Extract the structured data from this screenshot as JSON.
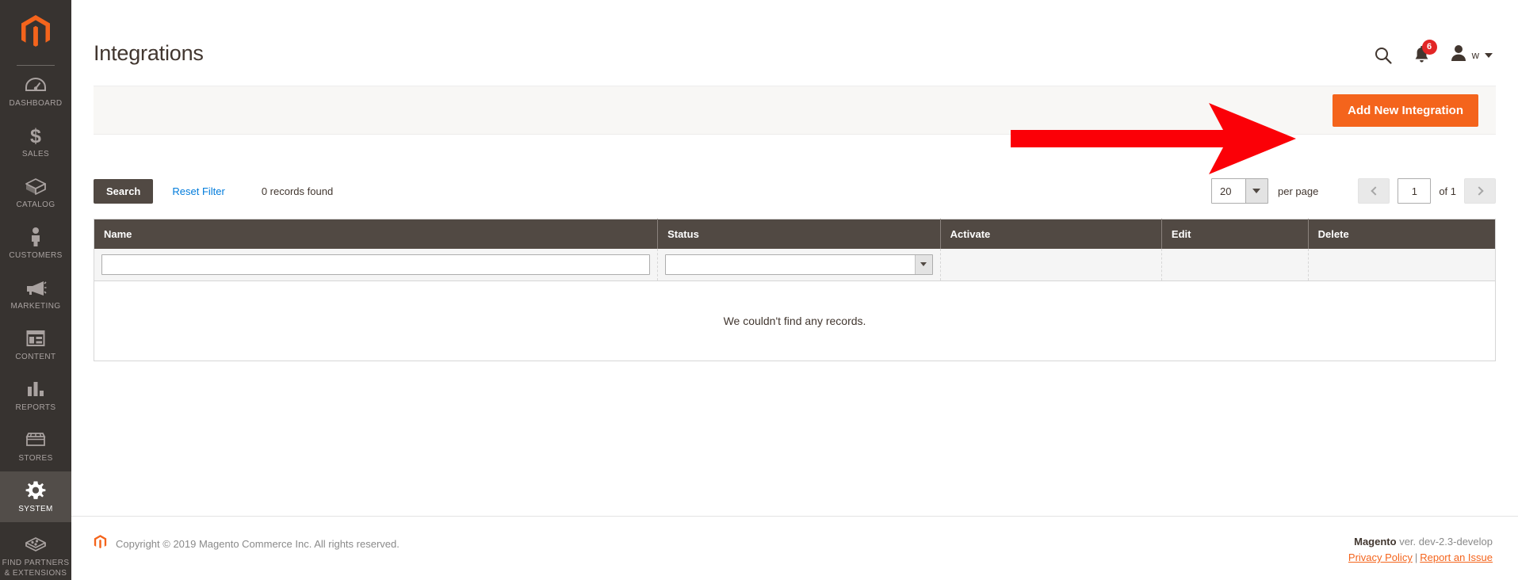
{
  "sidebar": {
    "logo_icon": "magento-logo-icon",
    "items": [
      {
        "label": "DASHBOARD",
        "icon": "dashboard-gauge-icon",
        "active": false
      },
      {
        "label": "SALES",
        "icon": "dollar-sign-icon",
        "active": false
      },
      {
        "label": "CATALOG",
        "icon": "box-icon",
        "active": false
      },
      {
        "label": "CUSTOMERS",
        "icon": "person-icon",
        "active": false
      },
      {
        "label": "MARKETING",
        "icon": "megaphone-icon",
        "active": false
      },
      {
        "label": "CONTENT",
        "icon": "layout-window-icon",
        "active": false
      },
      {
        "label": "REPORTS",
        "icon": "bar-chart-icon",
        "active": false
      },
      {
        "label": "STORES",
        "icon": "storefront-icon",
        "active": false
      },
      {
        "label": "SYSTEM",
        "icon": "gear-icon",
        "active": true
      },
      {
        "label": "FIND PARTNERS\n& EXTENSIONS",
        "label_line1": "FIND PARTNERS",
        "label_line2": "& EXTENSIONS",
        "icon": "extension-block-icon",
        "active": false
      }
    ]
  },
  "header": {
    "title": "Integrations",
    "search_icon": "search-icon",
    "notifications_icon": "bell-icon",
    "notifications_count": "6",
    "user_icon": "user-avatar-icon",
    "user_name": "w",
    "caret_icon": "chevron-down-icon"
  },
  "page_actions": {
    "add_new_integration_label": "Add New Integration"
  },
  "grid_toolbar": {
    "search_label": "Search",
    "reset_filter_label": "Reset Filter",
    "records_found": "0 records found",
    "per_page_value": "20",
    "per_page_label": "per page",
    "prev_icon": "chevron-left-icon",
    "next_icon": "chevron-right-icon",
    "page_value": "1",
    "of_total": "of 1"
  },
  "grid": {
    "columns": [
      "Name",
      "Status",
      "Activate",
      "Edit",
      "Delete"
    ],
    "filters": {
      "name_value": "",
      "name_placeholder": "",
      "status_value": "",
      "status_placeholder": ""
    },
    "rows": [],
    "empty_message": "We couldn't find any records."
  },
  "footer": {
    "logo_icon": "magento-logo-icon",
    "copyright": "Copyright © 2019 Magento Commerce Inc. All rights reserved.",
    "brand": "Magento",
    "version": "ver. dev-2.3-develop",
    "privacy_policy": "Privacy Policy",
    "separator": "|",
    "report_issue": "Report an Issue"
  },
  "annotation": {
    "arrow_icon": "red-arrow-right-annotation",
    "color": "#fb0007"
  },
  "colors": {
    "accent_orange": "#f4641c",
    "sidebar_bg": "#373330",
    "sidebar_active": "#524d49",
    "header_dark": "#514943",
    "link_blue": "#007bdb",
    "badge_red": "#e22626",
    "annotation_red": "#fb0007"
  }
}
